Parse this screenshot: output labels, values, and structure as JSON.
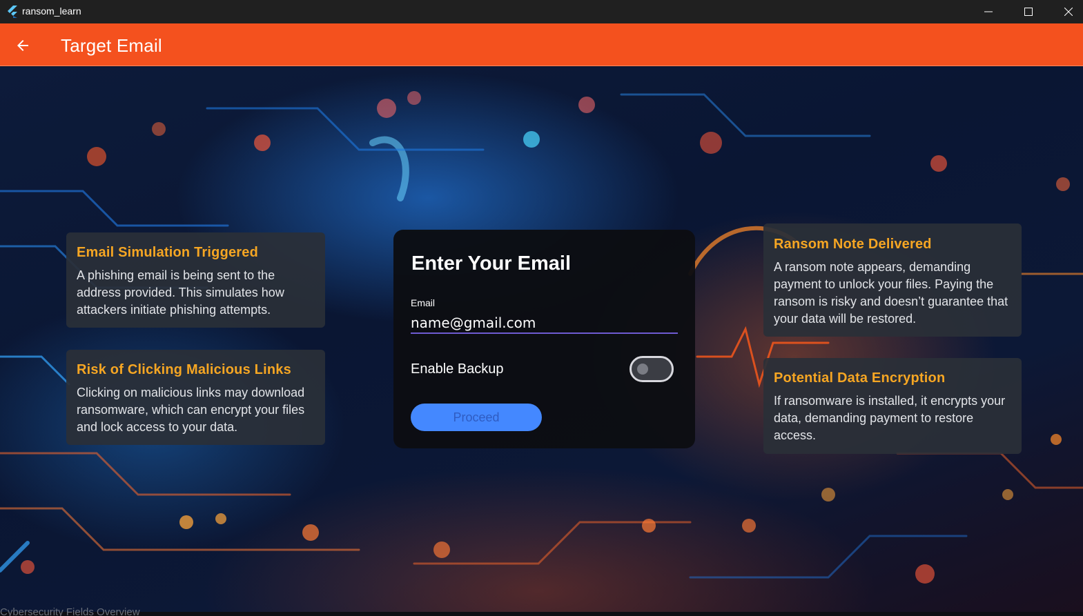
{
  "window": {
    "app_title": "ransom_learn",
    "minimize_icon": "minimize-icon",
    "maximize_icon": "maximize-icon",
    "close_icon": "close-icon"
  },
  "appbar": {
    "title": "Target Email",
    "back_icon": "arrow-left-icon",
    "color": "#f4511e"
  },
  "cards": {
    "email_simulation": {
      "title": "Email Simulation Triggered",
      "body": "A phishing email is being sent to the address provided. This simulates how attackers initiate phishing attempts."
    },
    "risk_links": {
      "title": "Risk of Clicking Malicious Links",
      "body": "Clicking on malicious links may download ransomware, which can encrypt your files and lock access to your data."
    },
    "ransom_note": {
      "title": "Ransom Note Delivered",
      "body": "A ransom note appears, demanding payment to unlock your files. Paying the ransom is risky and doesn’t guarantee that your data will be restored."
    },
    "data_encryption": {
      "title": "Potential Data Encryption",
      "body": "If ransomware is installed, it encrypts your data, demanding payment to restore access."
    }
  },
  "form": {
    "title": "Enter Your Email",
    "email_label": "Email",
    "email_value": "name@gmail.com",
    "backup_label": "Enable Backup",
    "backup_enabled": false,
    "proceed_label": "Proceed",
    "accent": "#6f5bd3",
    "button_color": "#4488ff"
  },
  "footer": {
    "partial_text": "Cybersecurity Fields Overview"
  },
  "card_title_color": "#f6a623"
}
